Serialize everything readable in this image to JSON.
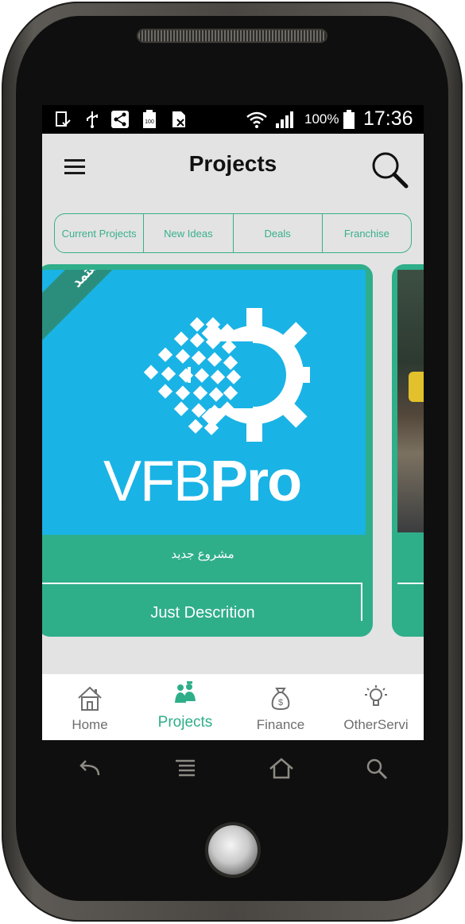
{
  "status_bar": {
    "battery_percent": "100%",
    "time": "17:36",
    "icons": [
      "tablet-check-icon",
      "usb-icon",
      "share-icon",
      "battery-100-icon",
      "sim-off-icon",
      "wifi-icon",
      "signal-icon",
      "battery-icon"
    ]
  },
  "app_bar": {
    "title": "Projects",
    "menu_icon": "hamburger-menu-icon",
    "search_icon": "search-icon"
  },
  "tabs": [
    {
      "label": "Current Projects"
    },
    {
      "label": "New Ideas"
    },
    {
      "label": "Deals"
    },
    {
      "label": "Franchise"
    }
  ],
  "card": {
    "ribbon": "معتمد",
    "brand_left": "VFB",
    "brand_right": "Pro",
    "subtitle": "مشروع جديد",
    "description": "Just Descrition"
  },
  "bottom_nav": [
    {
      "label": "Home",
      "icon": "house-icon",
      "active": false
    },
    {
      "label": "Projects",
      "icon": "workers-icon",
      "active": true
    },
    {
      "label": "Finance",
      "icon": "money-bag-icon",
      "active": false
    },
    {
      "label": "OtherServi",
      "icon": "lightbulb-icon",
      "active": false
    }
  ],
  "hardware_keys": [
    "back-icon",
    "menu-icon",
    "home-icon",
    "search-icon"
  ],
  "colors": {
    "accent": "#2fae8a",
    "card_image_bg": "#1ab3e5",
    "ribbon": "#2b8e7d",
    "screen_bg": "#e3e3e3"
  }
}
